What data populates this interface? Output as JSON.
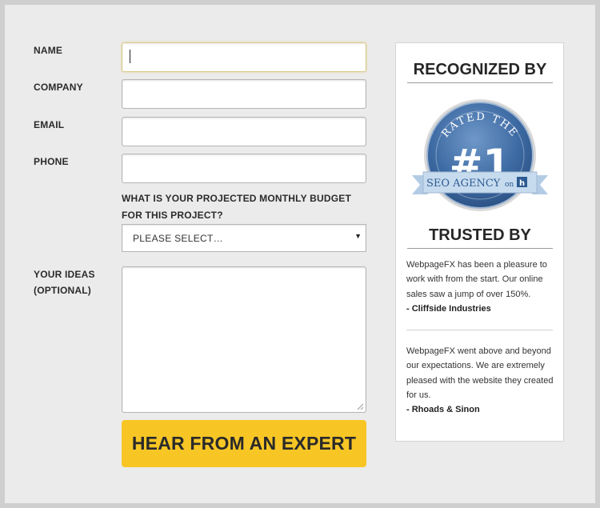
{
  "form": {
    "name_label": "NAME",
    "company_label": "COMPANY",
    "email_label": "EMAIL",
    "phone_label": "PHONE",
    "budget_question": "WHAT IS YOUR PROJECTED MONTHLY BUDGET FOR THIS PROJECT?",
    "budget_selected": "PLEASE SELECT…",
    "ideas_label_line1": "YOUR IDEAS",
    "ideas_label_line2": "(OPTIONAL)",
    "name_value": "",
    "company_value": "",
    "email_value": "",
    "phone_value": "",
    "ideas_value": "",
    "submit_label": "HEAR FROM AN EXPERT"
  },
  "sidebar": {
    "recognized_heading": "RECOGNIZED BY",
    "badge": {
      "top_text": "RATED THE",
      "number": "#1",
      "ribbon_text": "SEO AGENCY",
      "ribbon_suffix": "on",
      "logo_letter": "h"
    },
    "trusted_heading": "TRUSTED BY",
    "testimonials": [
      {
        "quote": "WebpageFX has been a pleasure to work with from the start. Our online sales saw a jump of over 150%.",
        "author": "- Cliffside Industries"
      },
      {
        "quote": "WebpageFX went above and beyond our expectations. We are extremely pleased with the website they created for us.",
        "author": "- Rhoads & Sinon"
      }
    ]
  },
  "colors": {
    "button": "#f7c625",
    "badge_blue": "#3d6aa3",
    "ribbon": "#c7dbef"
  }
}
